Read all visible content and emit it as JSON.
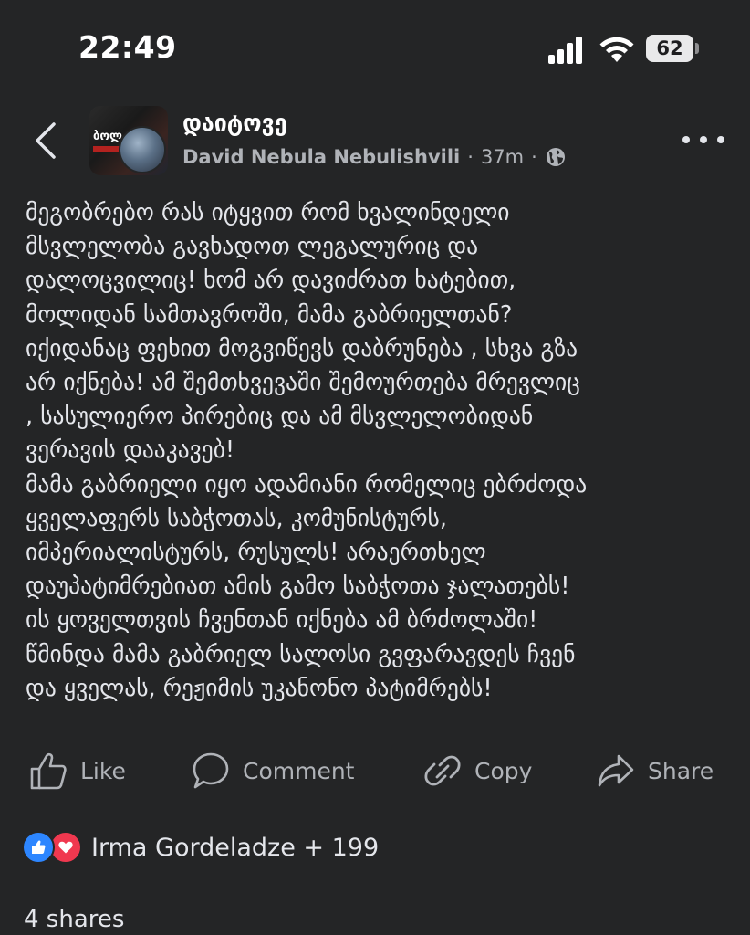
{
  "status_bar": {
    "time": "22:49",
    "battery_level": "62",
    "icons": [
      "signal-icon",
      "wifi-icon",
      "battery-icon"
    ]
  },
  "header": {
    "back_icon": "chevron-left-icon",
    "group_name": "დაიტოვე",
    "author": "David Nebula Nebulishvili",
    "separator": "·",
    "time_ago": "37m",
    "privacy_icon": "globe-icon",
    "more_icon": "more-dots-icon",
    "avatar_text": "ბოლ"
  },
  "post": {
    "lines": [
      "მეგობრებო რას იტყვით რომ ხვალინდელი",
      "მსვლელობა გავხადოთ ლეგალურიც და",
      "დალოცვილიც! ხომ არ დავიძრათ ხატებით,",
      "მოლიდან სამთავროში,  მამა გაბრიელთან?",
      "იქიდანაც ფეხით მოგვიწევს დაბრუნება , სხვა გზა",
      "არ იქნება!  ამ შემთხვევაში შემოურთება მრევლიც",
      ", სასულიერო პირებიც და ამ მსვლელობიდან",
      "ვერავის დააკავებ!",
      "მამა გაბრიელი იყო ადამიანი რომელიც ებრძოდა",
      "ყველაფერს საბჭოთას, კომუნისტურს,",
      "იმპერიალისტურს, რუსულს! არაერთხელ",
      "დაუპატიმრებიათ ამის გამო საბჭოთა ჯალათებს!",
      "ის ყოველთვის ჩვენთან იქნება ამ ბრძოლაში!",
      "წმინდა მამა გაბრიელ სალოსი გვფარავდეს ჩვენ",
      "და ყველას, რეჟიმის უკანონო პატიმრებს!"
    ]
  },
  "actions": {
    "like": {
      "label": "Like",
      "icon": "thumbs-up-icon"
    },
    "comment": {
      "label": "Comment",
      "icon": "comment-bubble-icon"
    },
    "copy": {
      "label": "Copy",
      "icon": "link-icon"
    },
    "share": {
      "label": "Share",
      "icon": "share-arrow-icon"
    }
  },
  "reactions": {
    "icons": [
      "like-reaction-icon",
      "love-reaction-icon"
    ],
    "text": "Irma Gordeladze + 199"
  },
  "shares": "4 shares",
  "colors": {
    "background": "#242526",
    "text_primary": "#e4e6eb",
    "text_secondary": "#b0b3b8",
    "like_blue": "#2d86ff",
    "love_red": "#f0384f"
  }
}
